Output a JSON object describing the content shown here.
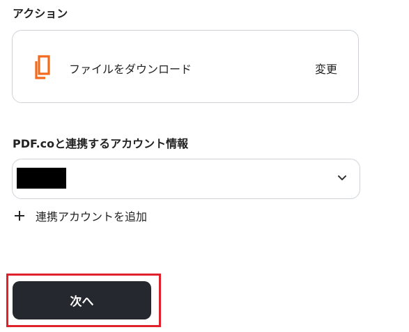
{
  "action_section": {
    "label": "アクション",
    "action_name": "ファイルをダウンロード",
    "change_label": "変更",
    "icon": "document-copy-icon",
    "icon_color": "#f26b1d"
  },
  "connection_section": {
    "label": "PDF.coと連携するアカウント情報",
    "selected_value_redacted": true,
    "chevron_icon": "chevron-down-icon"
  },
  "add_account": {
    "label": "連携アカウントを追加",
    "icon": "plus-icon"
  },
  "footer": {
    "next_label": "次へ",
    "button_color": "#25282e",
    "highlight_color": "#e0202a"
  }
}
